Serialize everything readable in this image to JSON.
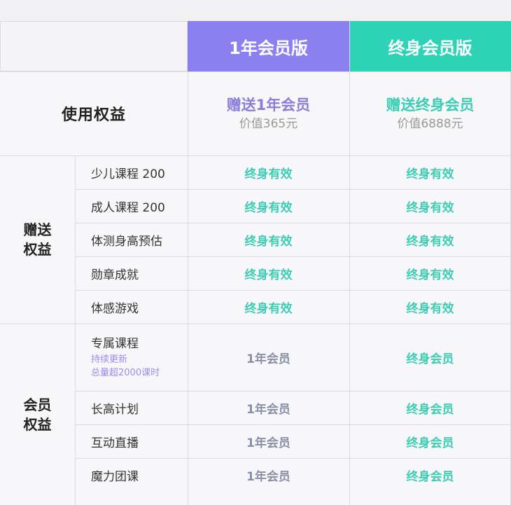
{
  "header": {
    "plan1": "1年会员版",
    "plan2": "终身会员版"
  },
  "rights": {
    "title": "使用权益",
    "plan1_gift": "赠送1年会员",
    "plan1_value": "价值365元",
    "plan2_gift": "赠送终身会员",
    "plan2_value": "价值6888元"
  },
  "groups": [
    {
      "label_line1": "赠送",
      "label_line2": "权益"
    },
    {
      "label_line1": "会员",
      "label_line2": "权益"
    }
  ],
  "gift_rows": [
    {
      "name": "少儿课程 200",
      "plan1": "终身有效",
      "plan2": "终身有效"
    },
    {
      "name": "成人课程 200",
      "plan1": "终身有效",
      "plan2": "终身有效"
    },
    {
      "name": "体测身高预估",
      "plan1": "终身有效",
      "plan2": "终身有效"
    },
    {
      "name": "勋章成就",
      "plan1": "终身有效",
      "plan2": "终身有效"
    },
    {
      "name": "体感游戏",
      "plan1": "终身有效",
      "plan2": "终身有效"
    }
  ],
  "member_rows": [
    {
      "name": "专属课程",
      "note1": "持续更新",
      "note2": "总量超2000课时",
      "plan1": "1年会员",
      "plan2": "终身会员"
    },
    {
      "name": "长高计划",
      "plan1": "1年会员",
      "plan2": "终身会员"
    },
    {
      "name": "互动直播",
      "plan1": "1年会员",
      "plan2": "终身会员"
    },
    {
      "name": "魔力团课",
      "plan1": "1年会员",
      "plan2": "终身会员"
    }
  ],
  "colors": {
    "plan1_header": "#8c7ff0",
    "plan2_header": "#2ed3b7",
    "teal_text": "#3ccdb5",
    "purple_text": "#8a7fd8"
  }
}
